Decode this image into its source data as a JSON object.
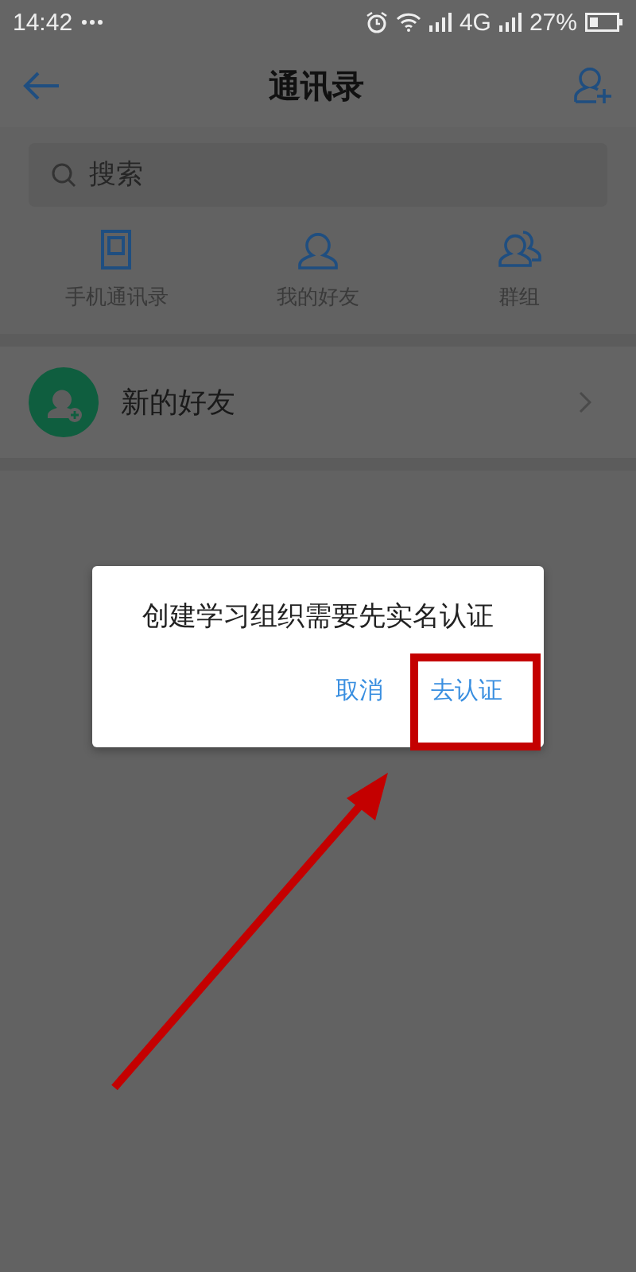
{
  "status_bar": {
    "time": "14:42",
    "network": "4G",
    "battery": "27%"
  },
  "header": {
    "title": "通讯录"
  },
  "search": {
    "placeholder": "搜索"
  },
  "shortcuts": [
    {
      "kind": "phone",
      "label": "手机通讯录"
    },
    {
      "kind": "person",
      "label": "我的好友"
    },
    {
      "kind": "group",
      "label": "群组"
    }
  ],
  "list": [
    {
      "label": "新的好友"
    }
  ],
  "dialog": {
    "message": "创建学习组织需要先实名认证",
    "buttons": [
      {
        "label": "取消"
      },
      {
        "label": "去认证"
      }
    ]
  }
}
